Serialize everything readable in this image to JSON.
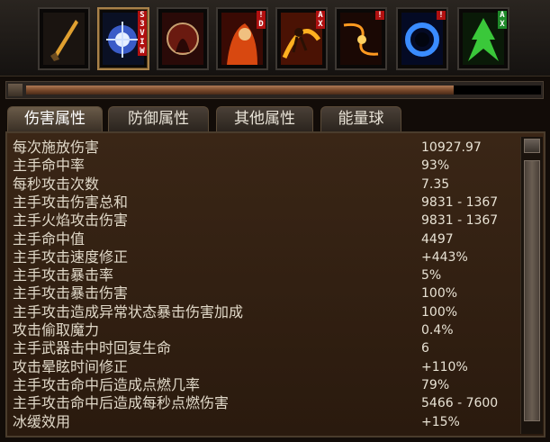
{
  "skills": [
    {
      "name": "sword-skill-icon",
      "tag": ""
    },
    {
      "name": "lightning-burst-skill-icon",
      "tag": "S\n3\nV\nI\nW"
    },
    {
      "name": "hooded-figure-skill-icon",
      "tag": ""
    },
    {
      "name": "fire-warrior-skill-icon",
      "tag": "!\nD"
    },
    {
      "name": "fire-leap-skill-icon",
      "tag": "A\nX"
    },
    {
      "name": "fire-whip-skill-icon",
      "tag": "!"
    },
    {
      "name": "blue-ring-skill-icon",
      "tag": "!"
    },
    {
      "name": "green-spirit-skill-icon",
      "tag": "A\nX"
    }
  ],
  "progress": 0.83,
  "tabs": [
    "伤害属性",
    "防御属性",
    "其他属性",
    "能量球"
  ],
  "stats": [
    {
      "label": "每次施放伤害",
      "value": "10927.97"
    },
    {
      "label": "主手命中率",
      "value": "93%"
    },
    {
      "label": "每秒攻击次数",
      "value": "7.35"
    },
    {
      "label": "主手攻击伤害总和",
      "value": "9831 - 1367"
    },
    {
      "label": "主手火焰攻击伤害",
      "value": "9831 - 1367"
    },
    {
      "label": "主手命中值",
      "value": "4497"
    },
    {
      "label": "主手攻击速度修正",
      "value": "+443%"
    },
    {
      "label": "主手攻击暴击率",
      "value": "5%"
    },
    {
      "label": "主手攻击暴击伤害",
      "value": "100%"
    },
    {
      "label": "主手攻击造成异常状态暴击伤害加成",
      "value": "100%"
    },
    {
      "label": "攻击偷取魔力",
      "value": "0.4%"
    },
    {
      "label": "主手武器击中时回复生命",
      "value": "6"
    },
    {
      "label": "攻击晕眩时间修正",
      "value": "+110%"
    },
    {
      "label": "主手攻击命中后造成点燃几率",
      "value": "79%"
    },
    {
      "label": "主手攻击命中后造成每秒点燃伤害",
      "value": "5466 - 7600"
    },
    {
      "label": "冰缓效用",
      "value": "+15%"
    }
  ]
}
